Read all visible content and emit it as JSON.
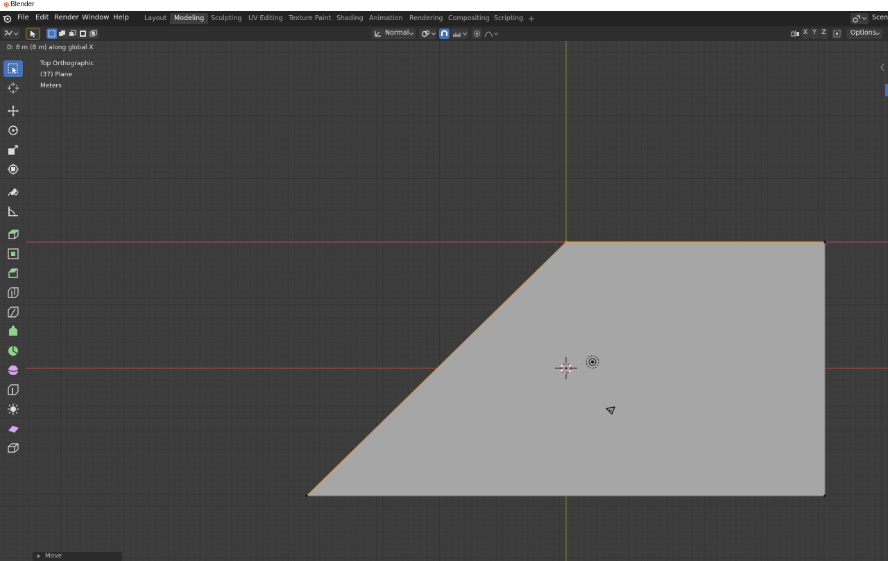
{
  "window": {
    "title": "Blender"
  },
  "menu": [
    {
      "id": "file",
      "label": "File"
    },
    {
      "id": "edit",
      "label": "Edit"
    },
    {
      "id": "render",
      "label": "Render"
    },
    {
      "id": "window",
      "label": "Window"
    },
    {
      "id": "help",
      "label": "Help"
    }
  ],
  "workspaces": {
    "tabs": [
      {
        "id": "layout",
        "label": "Layout"
      },
      {
        "id": "modeling",
        "label": "Modeling",
        "active": true
      },
      {
        "id": "sculpting",
        "label": "Sculpting"
      },
      {
        "id": "uv-editing",
        "label": "UV Editing"
      },
      {
        "id": "texture-paint",
        "label": "Texture Paint"
      },
      {
        "id": "shading",
        "label": "Shading"
      },
      {
        "id": "animation",
        "label": "Animation"
      },
      {
        "id": "rendering",
        "label": "Rendering"
      },
      {
        "id": "compositing",
        "label": "Compositing"
      },
      {
        "id": "scripting",
        "label": "Scripting"
      }
    ],
    "add_label": "+"
  },
  "scene": {
    "label": "Scene"
  },
  "header": {
    "orientation": "Normal",
    "axis_x": "X",
    "axis_y": "Y",
    "axis_z": "Z",
    "options": "Options"
  },
  "status": {
    "transform_info": "D: 8 m (8 m) along global X"
  },
  "viewport": {
    "view_name": "Top Orthographic",
    "object_name": "(37) Plane",
    "units": "Meters"
  },
  "last_operator": {
    "label": "Move"
  },
  "colors": {
    "accent": "#4772b3",
    "x_axis": "#c8504f",
    "y_axis": "#6a9a2c",
    "mesh_face": "#a5a6a5",
    "selected_edge": "#e88c3c"
  },
  "tools": [
    {
      "id": "select-box",
      "icon": "select-box-icon",
      "active": true
    },
    {
      "id": "cursor",
      "icon": "cursor-icon"
    },
    {
      "id": "move",
      "icon": "move-icon"
    },
    {
      "id": "rotate",
      "icon": "rotate-icon"
    },
    {
      "id": "scale",
      "icon": "scale-icon"
    },
    {
      "id": "transform",
      "icon": "transform-icon"
    },
    {
      "id": "annotate",
      "icon": "annotate-icon"
    },
    {
      "id": "measure",
      "icon": "measure-icon"
    },
    {
      "id": "extrude",
      "icon": "extrude-region-icon"
    },
    {
      "id": "inset",
      "icon": "inset-faces-icon"
    },
    {
      "id": "bevel",
      "icon": "bevel-icon"
    },
    {
      "id": "loop-cut",
      "icon": "loop-cut-icon"
    },
    {
      "id": "knife",
      "icon": "knife-icon"
    },
    {
      "id": "poly-build",
      "icon": "poly-build-icon"
    },
    {
      "id": "spin",
      "icon": "spin-icon"
    },
    {
      "id": "smooth",
      "icon": "smooth-icon"
    },
    {
      "id": "edge-slide",
      "icon": "edge-slide-icon"
    },
    {
      "id": "shrink-fatten",
      "icon": "shrink-fatten-icon"
    },
    {
      "id": "shear",
      "icon": "shear-icon"
    },
    {
      "id": "rip",
      "icon": "rip-region-icon"
    }
  ]
}
